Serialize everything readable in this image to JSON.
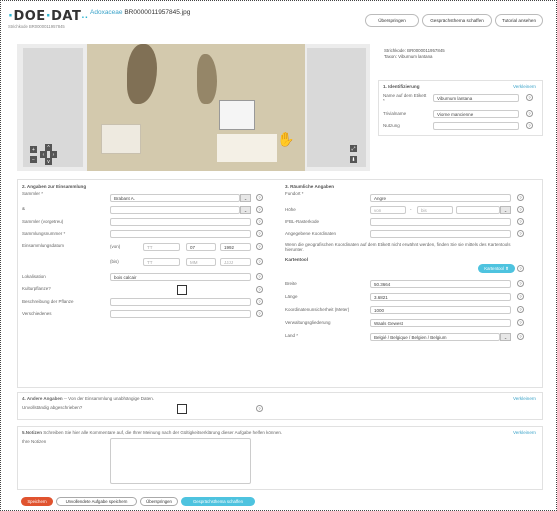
{
  "header": {
    "logo": {
      "a": "DOE",
      "sep1": "·",
      "b": "DAT",
      "sep2": "·",
      "dots": "··"
    },
    "barcode_small": "Strichkode BR0000011957845",
    "title_sci": "Adoxaceae",
    "title_code": "BR0000011957845.jpg",
    "buttons": [
      "Überspringen",
      "Gesprächsthema schaffen",
      "Tutorial ansehen"
    ]
  },
  "viewer": {
    "nav": {
      "zoom_in": "+",
      "zoom_out": "−",
      "left": "‹",
      "right": "›",
      "up": "^",
      "down": "v",
      "fullscreen": "⤢",
      "download": "⬇"
    }
  },
  "taxon": {
    "barcode": "Strichkode: BR0000011957845",
    "taxon": "Taxon: Viburnum lantana"
  },
  "identification": {
    "title": "1. Identifizierung",
    "link": "Verkleinern",
    "fields": [
      {
        "label": "Name auf dem Etikett *",
        "value": "Viburnum lantana"
      },
      {
        "label": "Trivialname",
        "value": "Viorne mancienne"
      },
      {
        "label": "Nutzung",
        "value": ""
      }
    ]
  },
  "collection": {
    "title": "2. Angaben zur Einsammlung",
    "fields": [
      {
        "label": "Sammler *",
        "value": "Brabant A."
      },
      {
        "label": "&",
        "value": ""
      },
      {
        "label": "Sammler (vorgetreu)",
        "value": ""
      },
      {
        "label": "Sammlungsnummer *",
        "value": ""
      },
      {
        "label": "Einsammlungsdatum",
        "value": ""
      },
      {
        "label": "Lokalisation",
        "value": "bois calcair"
      },
      {
        "label": "Kulturpflanze?",
        "value": ""
      },
      {
        "label": "Beschreibung der Pflanze",
        "value": ""
      },
      {
        "label": "Verschiedenes",
        "value": ""
      }
    ],
    "date_from": {
      "label": "(von)",
      "day": "TT",
      "month": "07",
      "year": "1992"
    },
    "date_to": {
      "label": "(bis)",
      "day": "TT",
      "month": "MM",
      "year": "JJJJ"
    }
  },
  "spatial": {
    "title": "3. Räumliche Angaben",
    "fields": [
      {
        "label": "Fundort *",
        "value": "Angre"
      },
      {
        "label": "Höhe",
        "value": ""
      },
      {
        "label": "IFBL-Rasterkode",
        "value": ""
      },
      {
        "label": "Angegebene Koordinaten",
        "value": ""
      }
    ],
    "height_from": "von",
    "height_sep": "-",
    "height_to": "bis",
    "note": "Wenn die geografischen Koordinaten auf dem Etikett nicht erwähnt werden, finden Sie sie mittels des Kartentools hierunter.",
    "map_title": "Kartentool",
    "map_button": "Kartentool ⬆",
    "coords": [
      {
        "label": "Breite",
        "value": "50.3664"
      },
      {
        "label": "Länge",
        "value": "3.6821"
      },
      {
        "label": "Koordinatenunsicherheit (Meter)",
        "value": "1000"
      },
      {
        "label": "Verwaltungsgliederung",
        "value": "Waals Gewest"
      },
      {
        "label": "Land *",
        "value": "Belgié / Belgique / Belgien / Belgium"
      }
    ]
  },
  "other": {
    "title": "4. Andere Angaben",
    "subtitle": " -- Von der Einsammlung unabhängige Daten.",
    "link": "Verkleinern",
    "field_label": "Unvollständig abgeschrieben?"
  },
  "notes": {
    "title": "5.Notizen",
    "subtitle": "Schreiben Sie hier alle Kommentare auf, die Ihrer Meinung nach der Gültigkeitserklärung dieser Aufgabe helfen können.",
    "link": "Verkleinern",
    "field_label": "Ihre Notizen"
  },
  "footer": {
    "save": "Speichern",
    "save_incomplete": "Unvollendete Aufgabe speichern",
    "skip": "Überspringen",
    "discuss": "Gesprächsthema schaffen"
  },
  "colors": {
    "accent": "#3ba3c9",
    "save": "#e0532f",
    "discuss": "#4ec3df"
  }
}
